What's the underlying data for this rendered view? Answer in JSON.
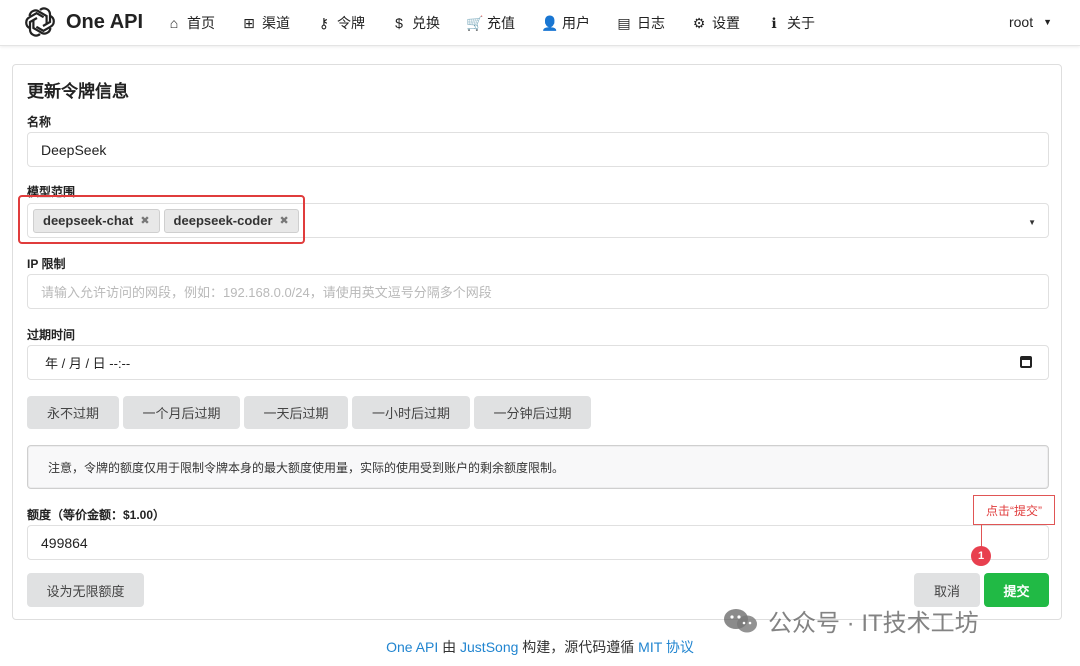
{
  "nav": {
    "brand": "One API",
    "items": [
      {
        "label": "首页",
        "icon": "⌂",
        "name": "home"
      },
      {
        "label": "渠道",
        "icon": "⊞",
        "name": "channels"
      },
      {
        "label": "令牌",
        "icon": "⚷",
        "name": "tokens"
      },
      {
        "label": "兑换",
        "icon": "$",
        "name": "redeem"
      },
      {
        "label": "充值",
        "icon": "🛒",
        "name": "topup"
      },
      {
        "label": "用户",
        "icon": "👤",
        "name": "users"
      },
      {
        "label": "日志",
        "icon": "▤",
        "name": "logs"
      },
      {
        "label": "设置",
        "icon": "⚙",
        "name": "settings"
      },
      {
        "label": "关于",
        "icon": "ℹ",
        "name": "about"
      }
    ],
    "user": "root",
    "user_caret": "▼"
  },
  "form": {
    "title": "更新令牌信息",
    "name_label": "名称",
    "name_value": "DeepSeek",
    "models_label": "模型范围",
    "models": [
      "deepseek-chat",
      "deepseek-coder"
    ],
    "chip_remove": "✖",
    "dropdown_caret": "▼",
    "ip_label": "IP 限制",
    "ip_placeholder": "请输入允许访问的网段，例如：192.168.0.0/24，请使用英文逗号分隔多个网段",
    "expire_label": "过期时间",
    "expire_value": "年 / 月 / 日 --:--",
    "expire_buttons": [
      "永不过期",
      "一个月后过期",
      "一天后过期",
      "一小时后过期",
      "一分钟后过期"
    ],
    "notice": "注意，令牌的额度仅用于限制令牌本身的最大额度使用量，实际的使用受到账户的剩余额度限制。",
    "quota_label": "额度（等价金额：$1.00）",
    "quota_value": "499864",
    "unlimited_button": "设为无限额度",
    "cancel_button": "取消",
    "submit_button": "提交"
  },
  "annotation": {
    "callout": "点击“提交”",
    "step": "1",
    "highlight_color": "#e03c3c"
  },
  "footer": {
    "part1": "One API",
    "part2": " 由 ",
    "part3": "JustSong",
    "part4": " 构建，源代码遵循 ",
    "part5": "MIT 协议"
  },
  "watermark": {
    "text": "公众号 · IT技术工坊"
  },
  "colors": {
    "submit": "#21ba45",
    "link": "#2185d0",
    "button_gray": "#e0e1e2"
  }
}
